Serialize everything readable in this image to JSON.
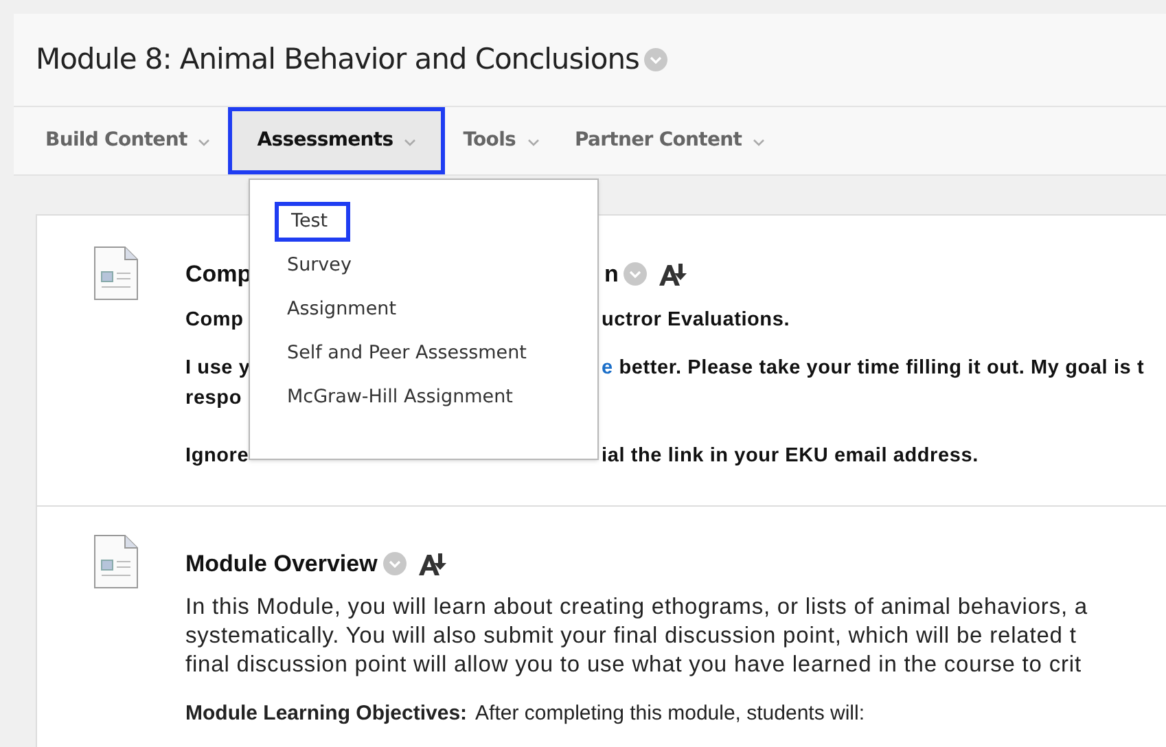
{
  "page_title": "Module 8: Animal Behavior and Conclusions",
  "toolbar": [
    {
      "label": "Build Content",
      "selected": false
    },
    {
      "label": "Assessments",
      "selected": true
    },
    {
      "label": "Tools",
      "selected": false
    },
    {
      "label": "Partner Content",
      "selected": false
    }
  ],
  "dropdown": [
    {
      "label": "Test",
      "selected": true
    },
    {
      "label": "Survey",
      "selected": false
    },
    {
      "label": "Assignment",
      "selected": false
    },
    {
      "label": "Self and Peer Assessment",
      "selected": false
    },
    {
      "label": "McGraw-Hill Assignment",
      "selected": false
    }
  ],
  "items": [
    {
      "title_left": "Comp",
      "title_right": "n",
      "lines": [
        {
          "left": "Comp",
          "right": "uctror Evaluations."
        },
        {
          "left": "I use y",
          "link": "e",
          "right": " better. Please take your time filling it out. My goal is t"
        },
        {
          "left": "respo"
        },
        {
          "left": "Ignore",
          "right": "ial the link in your EKU email address."
        }
      ]
    },
    {
      "title": "Module Overview",
      "paragraph": [
        "In this Module, you will learn about creating ethograms, or lists of animal behaviors, a",
        "systematically. You will also submit your final discussion point, which will be related t",
        "final discussion point will allow you to use what you have learned in the course to crit"
      ],
      "objectives_label": "Module Learning Objectives:",
      "objectives_text": "After completing this module, students will:"
    }
  ]
}
